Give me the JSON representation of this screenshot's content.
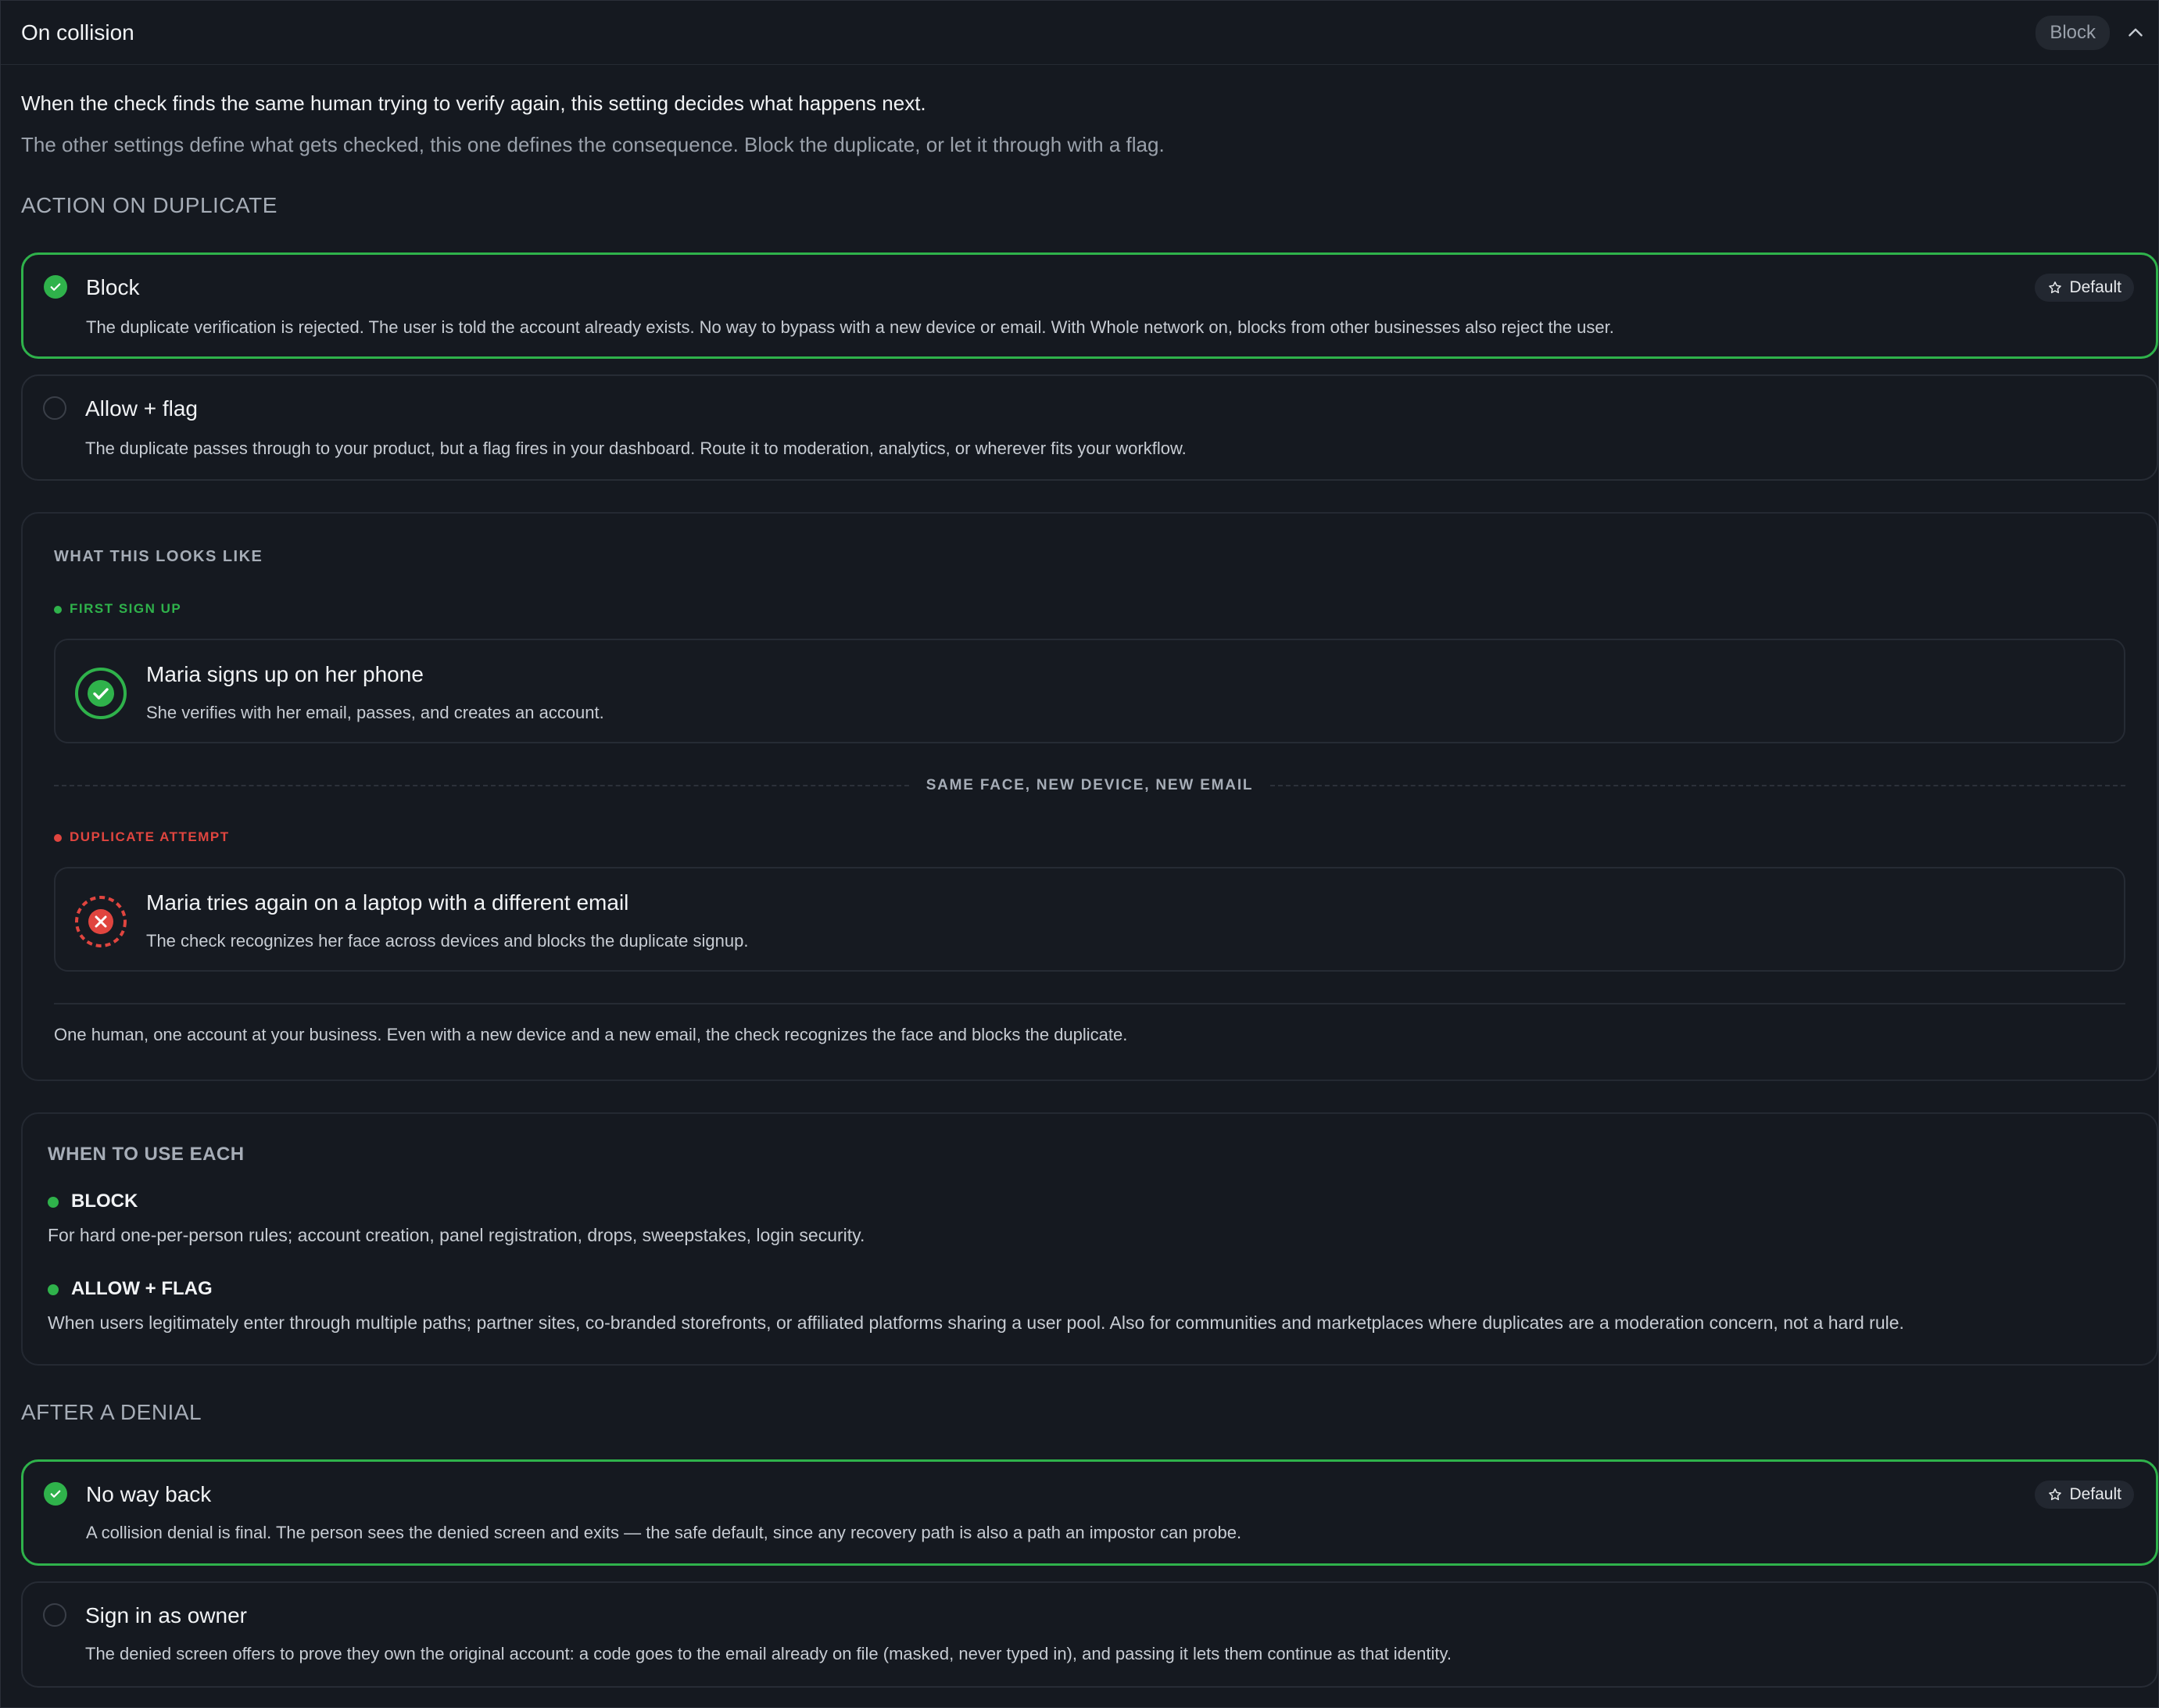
{
  "header": {
    "title": "On collision",
    "badge": "Block"
  },
  "intro": {
    "line1": "When the check finds the same human trying to verify again, this setting decides what happens next.",
    "line2": "The other settings define what gets checked, this one defines the consequence. Block the duplicate, or let it through with a flag."
  },
  "action_section": {
    "label": "ACTION ON DUPLICATE",
    "options": [
      {
        "title": "Block",
        "desc": "The duplicate verification is rejected. The user is told the account already exists. No way to bypass with a new device or email. With Whole network on, blocks from other businesses also reject the user.",
        "selected": true,
        "default_label": "Default"
      },
      {
        "title": "Allow + flag",
        "desc": "The duplicate passes through to your product, but a flag fires in your dashboard. Route it to moderation, analytics, or wherever fits your workflow.",
        "selected": false
      }
    ]
  },
  "example": {
    "label": "WHAT THIS LOOKS LIKE",
    "first_label": "FIRST SIGN UP",
    "first_title": "Maria signs up on her phone",
    "first_desc": "She verifies with her email, passes, and creates an account.",
    "divider": "SAME FACE, NEW DEVICE, NEW EMAIL",
    "dup_label": "DUPLICATE ATTEMPT",
    "dup_title": "Maria tries again on a laptop with a different email",
    "dup_desc": "The check recognizes her face across devices and blocks the duplicate signup.",
    "summary": "One human, one account at your business. Even with a new device and a new email, the check recognizes the face and blocks the duplicate."
  },
  "when_to_use": {
    "label": "WHEN TO USE EACH",
    "items": [
      {
        "name": "BLOCK",
        "desc": "For hard one-per-person rules; account creation, panel registration, drops, sweepstakes, login security."
      },
      {
        "name": "ALLOW + FLAG",
        "desc": "When users legitimately enter through multiple paths; partner sites, co-branded storefronts, or affiliated platforms sharing a user pool. Also for communities and marketplaces where duplicates are a moderation concern, not a hard rule."
      }
    ]
  },
  "denial_section": {
    "label": "AFTER A DENIAL",
    "options": [
      {
        "title": "No way back",
        "desc": "A collision denial is final. The person sees the denied screen and exits — the safe default, since any recovery path is also a path an impostor can probe.",
        "selected": true,
        "default_label": "Default"
      },
      {
        "title": "Sign in as owner",
        "desc": "The denied screen offers to prove they own the original account: a code goes to the email already on file (masked, never typed in), and passing it lets them continue as that identity.",
        "selected": false
      }
    ]
  },
  "colors": {
    "accent": "#2fb24b",
    "danger": "#e0453f",
    "background": "#151920"
  },
  "icons": [
    "chevron-up-icon",
    "check-icon",
    "star-icon",
    "x-icon"
  ]
}
